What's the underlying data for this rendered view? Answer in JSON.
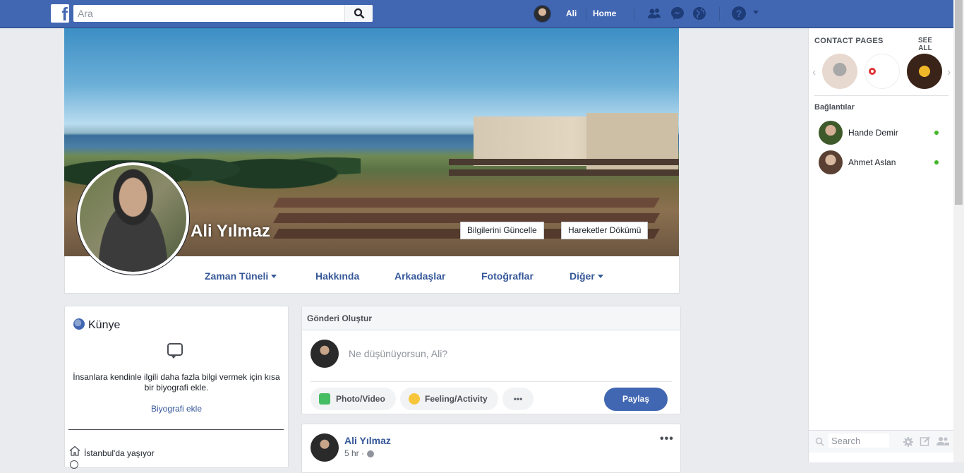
{
  "topbar": {
    "logo": "f",
    "search_placeholder": "Ara",
    "user_name": "Ali",
    "home_label": "Home",
    "help_label": "?"
  },
  "profile": {
    "name": "Ali Yılmaz",
    "update_info_label": "Bilgilerini Güncelle",
    "activity_log_label": "Hareketler Dökümü"
  },
  "nav": {
    "items": [
      {
        "label": "Zaman Tüneli"
      },
      {
        "label": "Hakkında"
      },
      {
        "label": "Arkadaşlar"
      },
      {
        "label": "Fotoğraflar"
      },
      {
        "label": "Diğer"
      }
    ]
  },
  "intro": {
    "title": "Künye",
    "description": "İnsanlara kendinle ilgili daha fazla bilgi vermek için kısa bir biyografi ekle.",
    "add_bio_label": "Biyografi ekle",
    "lives_in": "İstanbul'da yaşıyor"
  },
  "composer": {
    "title": "Gönderi Oluştur",
    "placeholder": "Ne düşünüyorsun, Ali?",
    "photo_label": "Photo/Video",
    "feeling_label": "Feeling/Activity",
    "more_label": "•••",
    "share_label": "Paylaş"
  },
  "post": {
    "author": "Ali Yılmaz",
    "time": "5 hr ·",
    "more_label": "•••"
  },
  "sidebar": {
    "contact_pages_title": "CONTACT PAGES",
    "see_all_label": "SEE ALL",
    "connections_title": "Bağlantılar",
    "contacts": [
      {
        "name": "Hande Demir"
      },
      {
        "name": "Ahmet Aslan"
      }
    ],
    "search_placeholder": "Search"
  },
  "colors": {
    "brand": "#4267b2",
    "link": "#365899",
    "online": "#42b72a"
  }
}
